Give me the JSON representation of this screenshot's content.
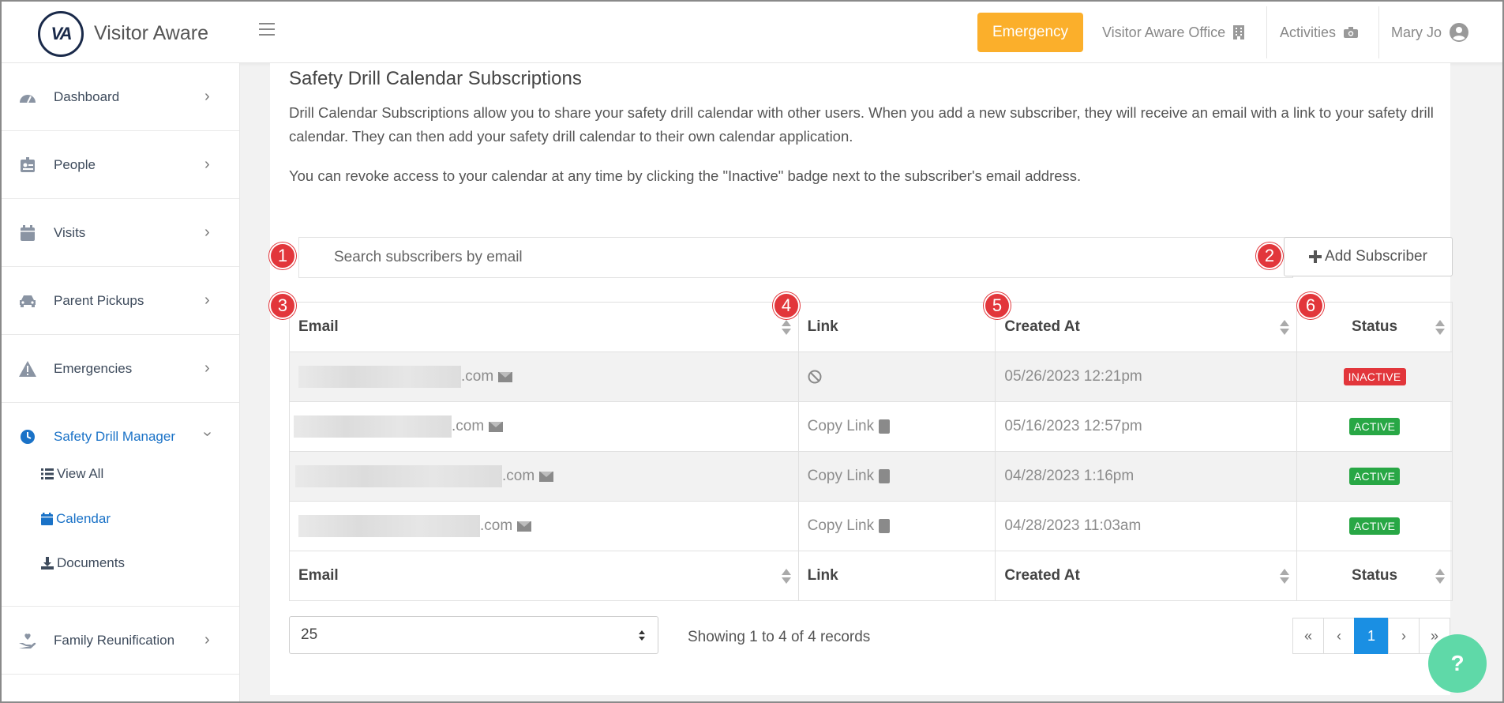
{
  "app": {
    "brand": "Visitor Aware",
    "logo_text": "VA"
  },
  "topbar": {
    "emergency_label": "Emergency",
    "office_label": "Visitor Aware Office",
    "activities_label": "Activities",
    "user_label": "Mary Jo"
  },
  "sidebar": {
    "items": [
      {
        "label": "Dashboard",
        "icon": "gauge-icon"
      },
      {
        "label": "People",
        "icon": "id-badge-icon"
      },
      {
        "label": "Visits",
        "icon": "calendar-icon"
      },
      {
        "label": "Parent Pickups",
        "icon": "car-icon"
      },
      {
        "label": "Emergencies",
        "icon": "warning-icon"
      },
      {
        "label": "Safety Drill Manager",
        "icon": "clock-icon"
      },
      {
        "label": "Family Reunification",
        "icon": "hand-heart-icon"
      }
    ],
    "sub_items": [
      {
        "label": "View All",
        "icon": "list-icon"
      },
      {
        "label": "Calendar",
        "icon": "calendar-icon"
      },
      {
        "label": "Documents",
        "icon": "download-icon"
      }
    ]
  },
  "main": {
    "title": "Safety Drill Calendar Subscriptions",
    "description1": "Drill Calendar Subscriptions allow you to share your safety drill calendar with other users. When you add a new subscriber, they will receive an email with a link to your safety drill calendar. They can then add your safety drill calendar to their own calendar application.",
    "description2": "You can revoke access to your calendar at any time by clicking the \"Inactive\" badge next to the subscriber's email address.",
    "search_placeholder": "Search subscribers by email",
    "add_button_label": "Add Subscriber",
    "table": {
      "headers": [
        "Email",
        "Link",
        "Created At",
        "Status"
      ],
      "rows": [
        {
          "email_suffix": ".com",
          "link": "",
          "created_at": "05/26/2023 12:21pm",
          "status": "INACTIVE"
        },
        {
          "email_suffix": ".com",
          "link": "Copy Link",
          "created_at": "05/16/2023 12:57pm",
          "status": "ACTIVE"
        },
        {
          "email_suffix": ".com",
          "link": "Copy Link",
          "created_at": "04/28/2023 1:16pm",
          "status": "ACTIVE"
        },
        {
          "email_suffix": ".com",
          "link": "Copy Link",
          "created_at": "04/28/2023 11:03am",
          "status": "ACTIVE"
        }
      ]
    },
    "page_size": "25",
    "records_text": "Showing 1 to 4 of 4 records",
    "pager": {
      "first": "«",
      "prev": "‹",
      "current": "1",
      "next": "›",
      "last": "»"
    }
  },
  "markers": [
    "1",
    "2",
    "3",
    "4",
    "5",
    "6"
  ],
  "help_label": "?",
  "colors": {
    "emergency": "#fbaf2b",
    "active": "#28a745",
    "inactive": "#e2363b",
    "accent": "#1a8fe3",
    "help": "#5fd9a8",
    "marker": "#e2363b"
  }
}
